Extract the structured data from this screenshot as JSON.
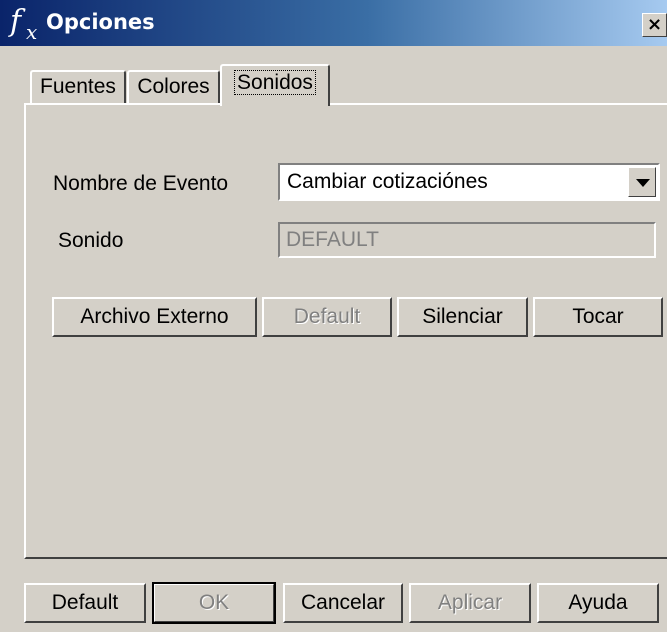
{
  "window": {
    "title": "Opciones",
    "close_glyph": "×",
    "app_icon": "fx-icon"
  },
  "tabs": [
    {
      "label": "Fuentes"
    },
    {
      "label": "Colores"
    },
    {
      "label": "Sonidos",
      "active": true
    }
  ],
  "form": {
    "event_label": "Nombre de Evento",
    "event_value": "Cambiar cotizaciónes",
    "sound_label": "Sonido",
    "sound_value": "DEFAULT"
  },
  "action_buttons": {
    "external": "Archivo Externo",
    "default": "Default",
    "mute": "Silenciar",
    "play": "Tocar"
  },
  "footer_buttons": {
    "default": "Default",
    "ok": "OK",
    "cancel": "Cancelar",
    "apply": "Aplicar",
    "help": "Ayuda"
  }
}
